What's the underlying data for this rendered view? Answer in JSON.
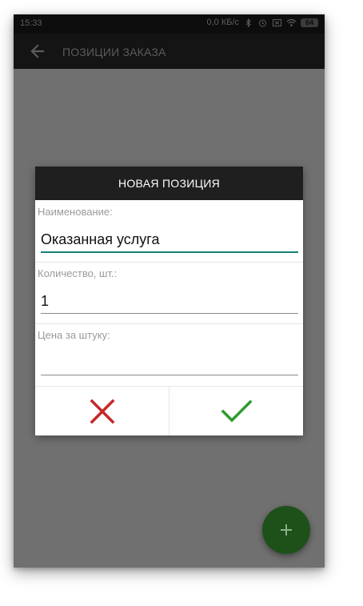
{
  "status_bar": {
    "time": "15:33",
    "network_speed": "0,0 КБ/с",
    "battery_level": "64",
    "icons": [
      "bluetooth-icon",
      "alarm-icon",
      "sim-icon",
      "wifi-icon",
      "battery-icon"
    ]
  },
  "app_bar": {
    "back_icon": "arrow-back-icon",
    "title": "ПОЗИЦИИ ЗАКАЗА"
  },
  "dialog": {
    "title": "НОВАЯ ПОЗИЦИЯ",
    "fields": [
      {
        "label": "Наименование:",
        "value": "Оказанная услуга",
        "placeholder": ""
      },
      {
        "label": "Количество, шт.:",
        "value": "1",
        "placeholder": ""
      },
      {
        "label": "Цена за штуку:",
        "value": "",
        "placeholder": ""
      }
    ],
    "cancel_icon": "close-icon",
    "confirm_icon": "check-icon"
  },
  "fab": {
    "icon": "plus-icon"
  },
  "colors": {
    "accent": "#167f76",
    "cancel": "#c62828",
    "confirm": "#2e9a2e",
    "fab": "#1d5119"
  }
}
